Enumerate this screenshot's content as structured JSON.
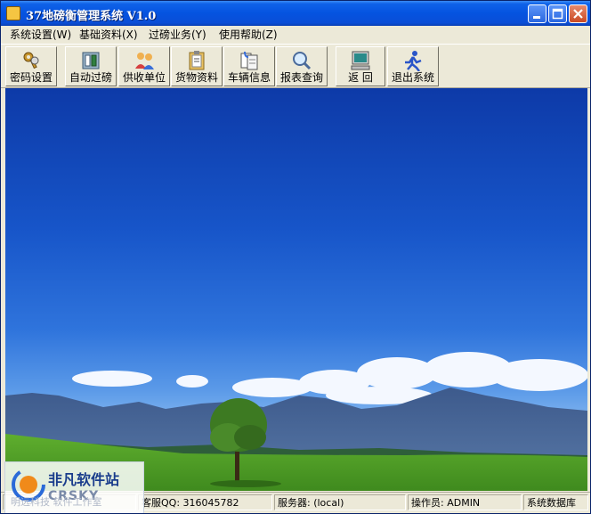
{
  "window": {
    "title": "37地磅衡管理系统 V1.0"
  },
  "menu": [
    {
      "label": "系统设置(W)"
    },
    {
      "label": "基础资料(X)"
    },
    {
      "label": "过磅业务(Y)"
    },
    {
      "label": "使用帮助(Z)"
    }
  ],
  "toolbar": [
    {
      "label": "密码设置",
      "icon": "keys-icon"
    },
    {
      "label": "自动过磅",
      "icon": "scale-icon"
    },
    {
      "label": "供收单位",
      "icon": "users-icon"
    },
    {
      "label": "货物资料",
      "icon": "clipboard-icon"
    },
    {
      "label": "车辆信息",
      "icon": "vehicle-docs-icon"
    },
    {
      "label": "报表查询",
      "icon": "magnifier-icon"
    },
    {
      "label": "返  回",
      "icon": "computer-icon"
    },
    {
      "label": "退出系统",
      "icon": "running-man-icon"
    }
  ],
  "status": {
    "qq": "客服QQ: 316045782",
    "server": "服务器: (local)",
    "operator": "操作员: ADMIN",
    "database": "系统数据库"
  },
  "watermark": {
    "brand": "非凡软件站",
    "sub": "CRSKY",
    "faint": "明远科技 软件工作室"
  },
  "colors": {
    "titlebar": "#0553e0",
    "window_bg": "#ece9d8",
    "sky": "#1755c9",
    "grass": "#4ea02a"
  }
}
